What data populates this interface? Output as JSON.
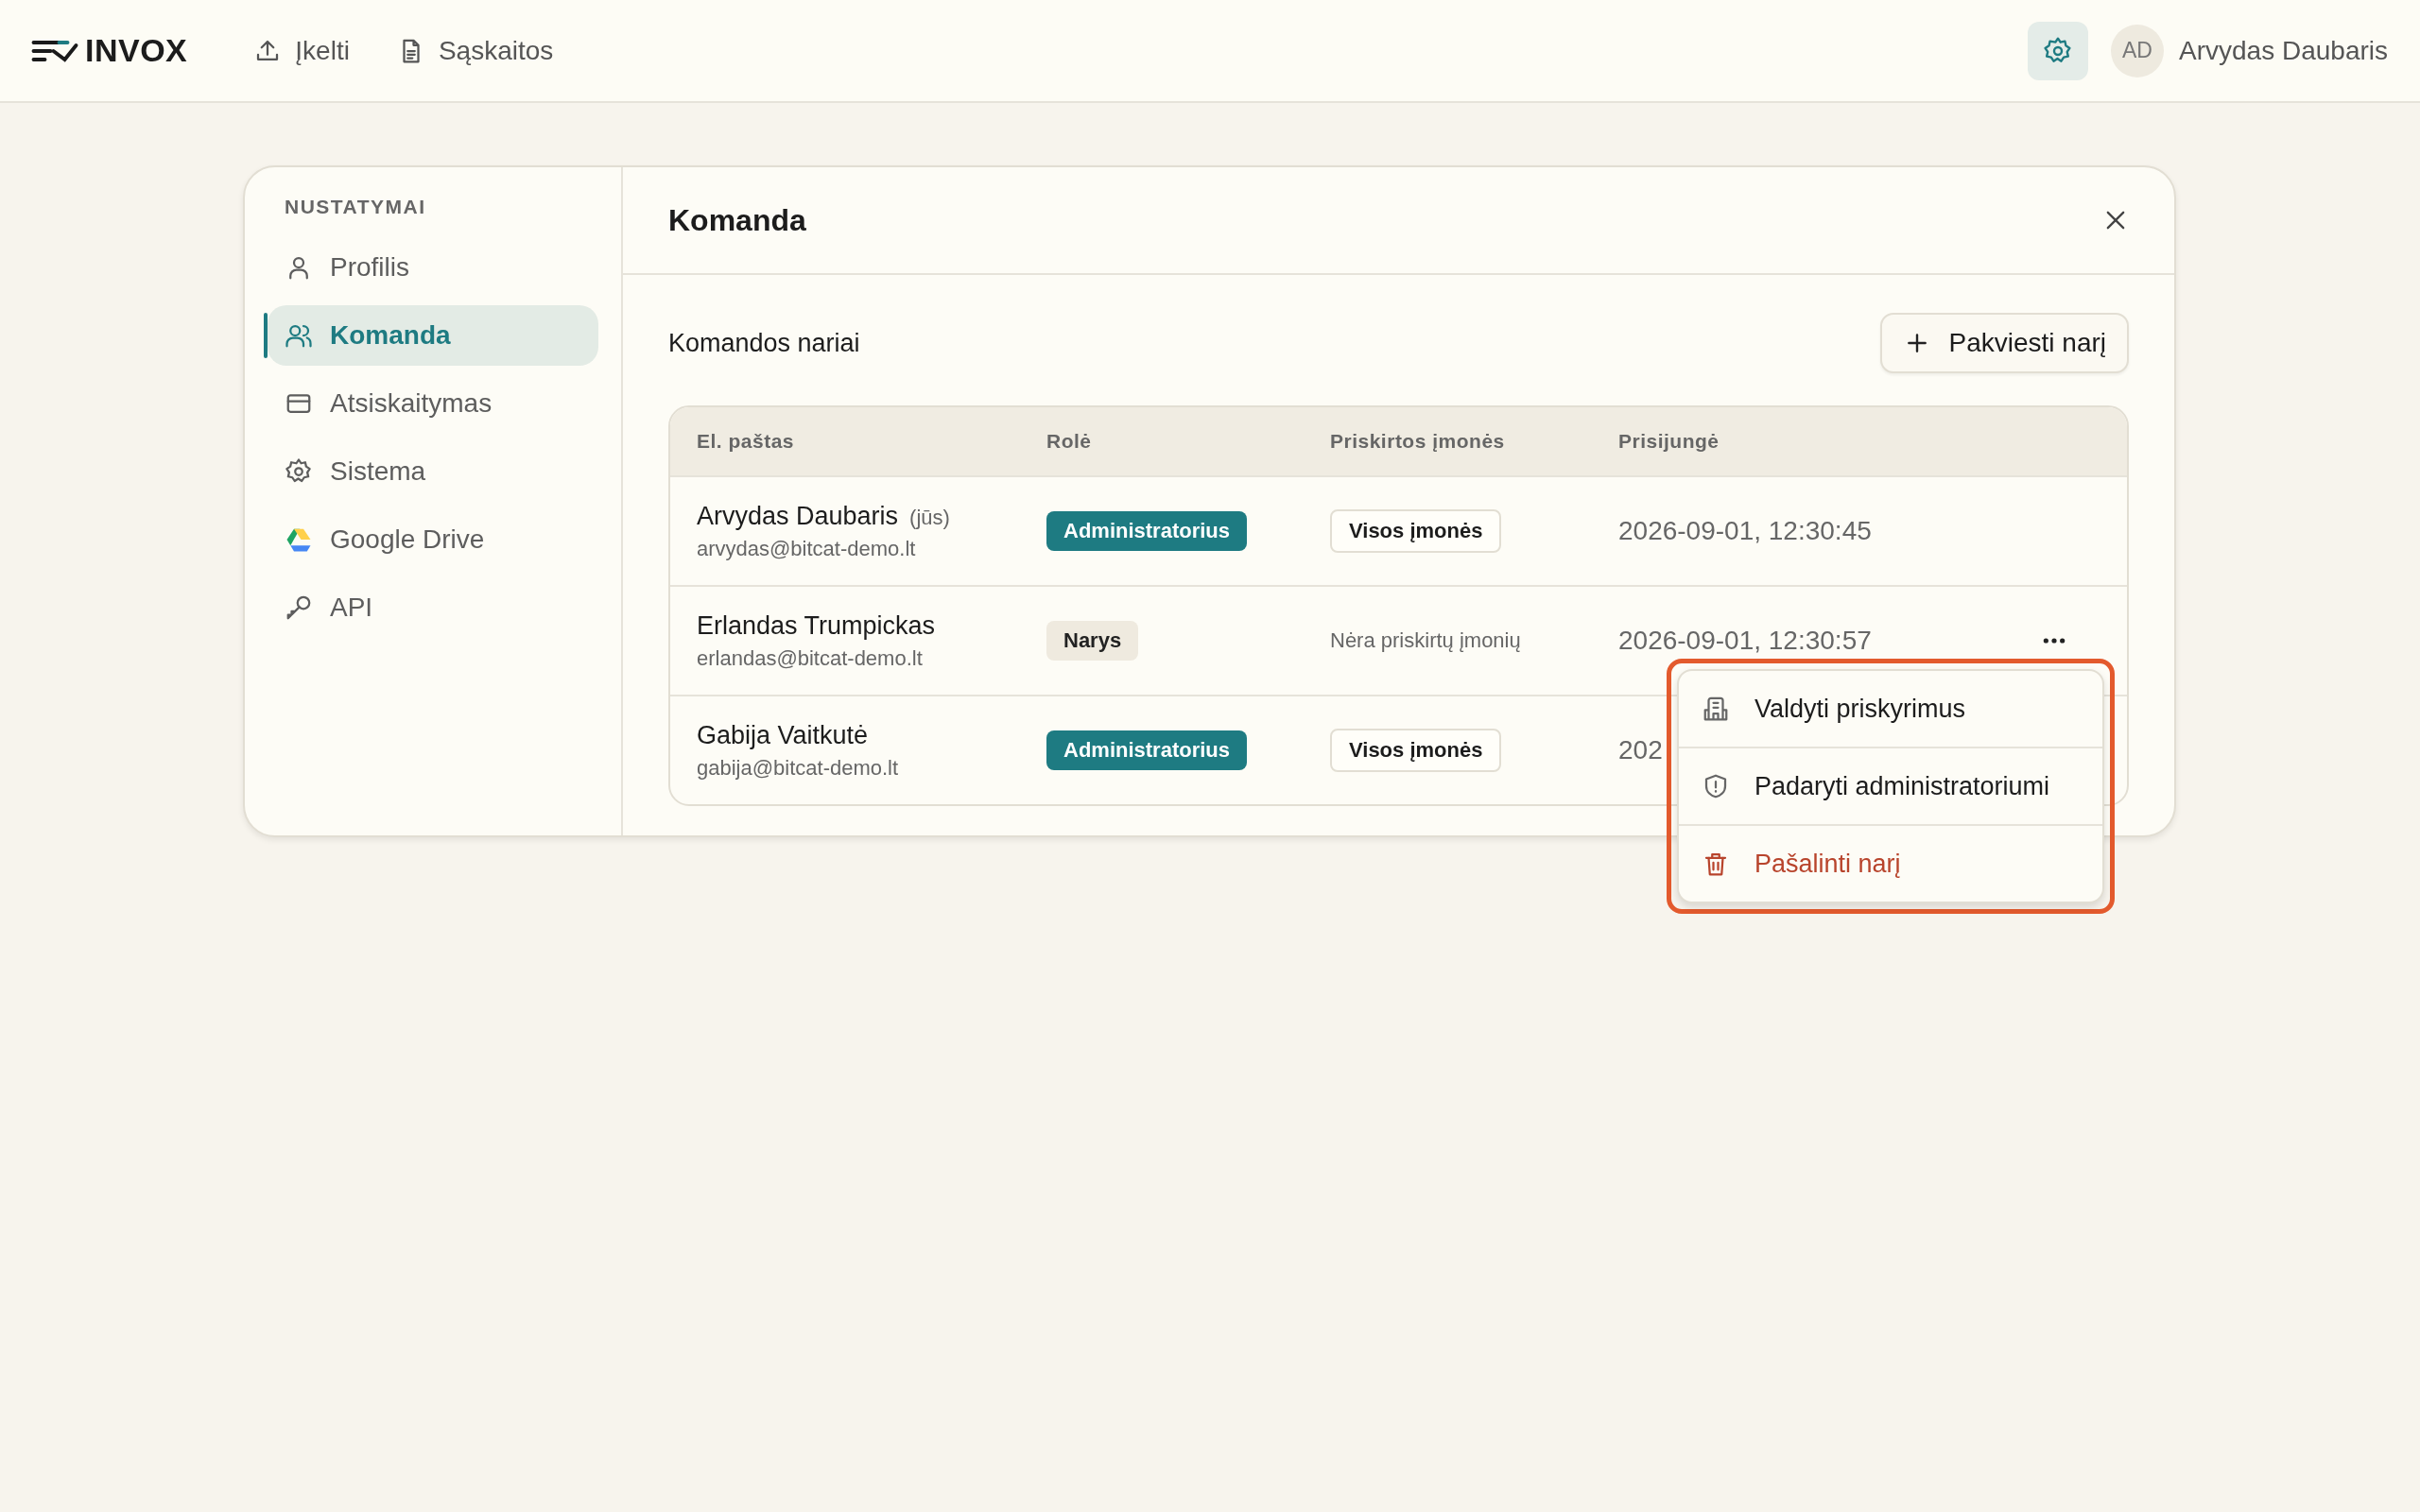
{
  "topbar": {
    "logo": "INVOX",
    "nav": [
      {
        "label": "Įkelti"
      },
      {
        "label": "Sąskaitos"
      }
    ],
    "avatar": "AD",
    "user": "Arvydas Daubaris"
  },
  "sidebar": {
    "heading": "NUSTATYMAI",
    "items": [
      {
        "label": "Profilis",
        "selected": false
      },
      {
        "label": "Komanda",
        "selected": true
      },
      {
        "label": "Atsiskaitymas",
        "selected": false
      },
      {
        "label": "Sistema",
        "selected": false
      },
      {
        "label": "Google Drive",
        "selected": false
      },
      {
        "label": "API",
        "selected": false
      }
    ]
  },
  "panel": {
    "title": "Komanda",
    "section_title": "Komandos nariai",
    "invite_button": "Pakviesti narį",
    "table": {
      "columns": [
        "El. paštas",
        "Rolė",
        "Priskirtos įmonės",
        "Prisijungė"
      ],
      "rows": [
        {
          "name": "Arvydas Daubaris",
          "note": "(jūs)",
          "email": "arvydas@bitcat-demo.lt",
          "role": {
            "label": "Administratorius",
            "kind": "admin"
          },
          "companies": {
            "label": "Visos įmonės",
            "kind": "badge"
          },
          "login": "2026-09-01, 12:30:45",
          "has_menu": false
        },
        {
          "name": "Erlandas Trumpickas",
          "email": "erlandas@bitcat-demo.lt",
          "role": {
            "label": "Narys",
            "kind": "member"
          },
          "companies": {
            "label": "Nėra priskirtų įmonių",
            "kind": "text"
          },
          "login": "2026-09-01, 12:30:57",
          "has_menu": true
        },
        {
          "name": "Gabija Vaitkutė",
          "email": "gabija@bitcat-demo.lt",
          "role": {
            "label": "Administratorius",
            "kind": "admin"
          },
          "companies": {
            "label": "Visos įmonės",
            "kind": "badge"
          },
          "login": "202"
        }
      ]
    }
  },
  "menu": {
    "highlighted": true,
    "items": [
      {
        "label": "Valdyti priskyrimus",
        "kind": "normal"
      },
      {
        "label": "Padaryti administratoriumi",
        "kind": "normal"
      },
      {
        "label": "Pašalinti narį",
        "kind": "danger"
      }
    ]
  }
}
